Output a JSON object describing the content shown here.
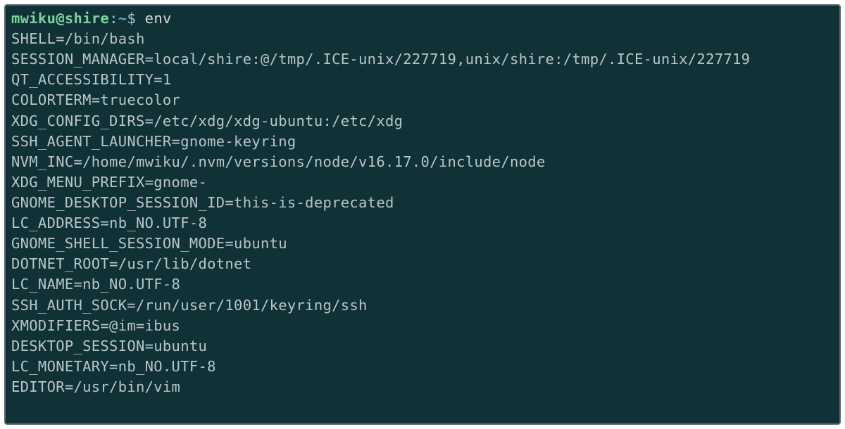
{
  "prompt": {
    "user": "mwiku@shire",
    "colon": ":",
    "path": "~",
    "dollar": "$ ",
    "command": "env"
  },
  "output": [
    "SHELL=/bin/bash",
    "SESSION_MANAGER=local/shire:@/tmp/.ICE-unix/227719,unix/shire:/tmp/.ICE-unix/227719",
    "QT_ACCESSIBILITY=1",
    "COLORTERM=truecolor",
    "XDG_CONFIG_DIRS=/etc/xdg/xdg-ubuntu:/etc/xdg",
    "SSH_AGENT_LAUNCHER=gnome-keyring",
    "NVM_INC=/home/mwiku/.nvm/versions/node/v16.17.0/include/node",
    "XDG_MENU_PREFIX=gnome-",
    "GNOME_DESKTOP_SESSION_ID=this-is-deprecated",
    "LC_ADDRESS=nb_NO.UTF-8",
    "GNOME_SHELL_SESSION_MODE=ubuntu",
    "DOTNET_ROOT=/usr/lib/dotnet",
    "LC_NAME=nb_NO.UTF-8",
    "SSH_AUTH_SOCK=/run/user/1001/keyring/ssh",
    "XMODIFIERS=@im=ibus",
    "DESKTOP_SESSION=ubuntu",
    "LC_MONETARY=nb_NO.UTF-8",
    "EDITOR=/usr/bin/vim"
  ]
}
